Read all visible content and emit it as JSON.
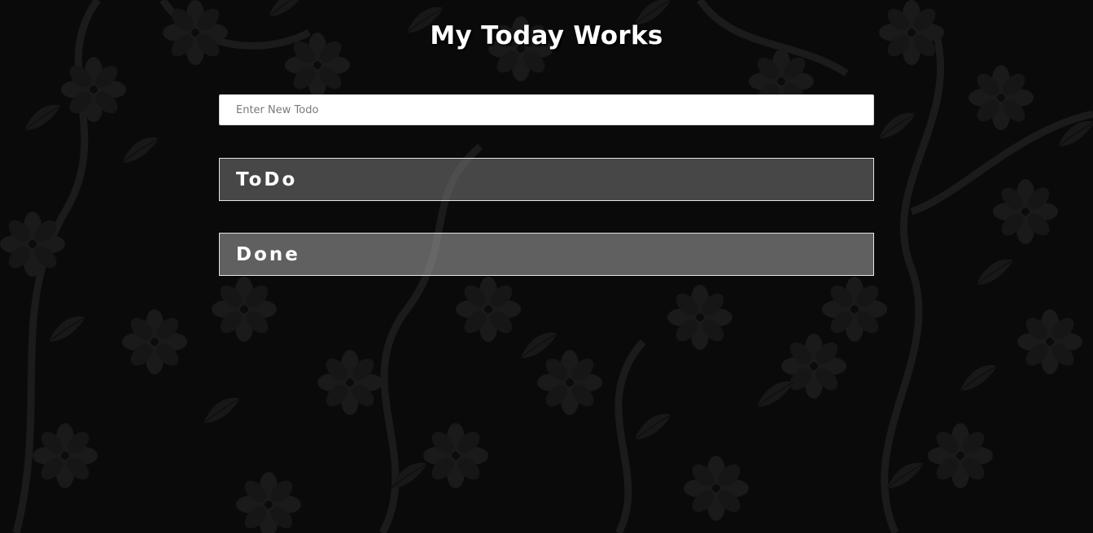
{
  "page": {
    "title": "My Today Works",
    "background_color": "#0a0a0a",
    "pattern_color": "#1f1f1f"
  },
  "new_todo": {
    "placeholder": "Enter New Todo",
    "value": ""
  },
  "sections": {
    "todo": {
      "label": "ToDo",
      "color": "#6e6e6e"
    },
    "done": {
      "label": "Done",
      "color": "#969696"
    }
  }
}
